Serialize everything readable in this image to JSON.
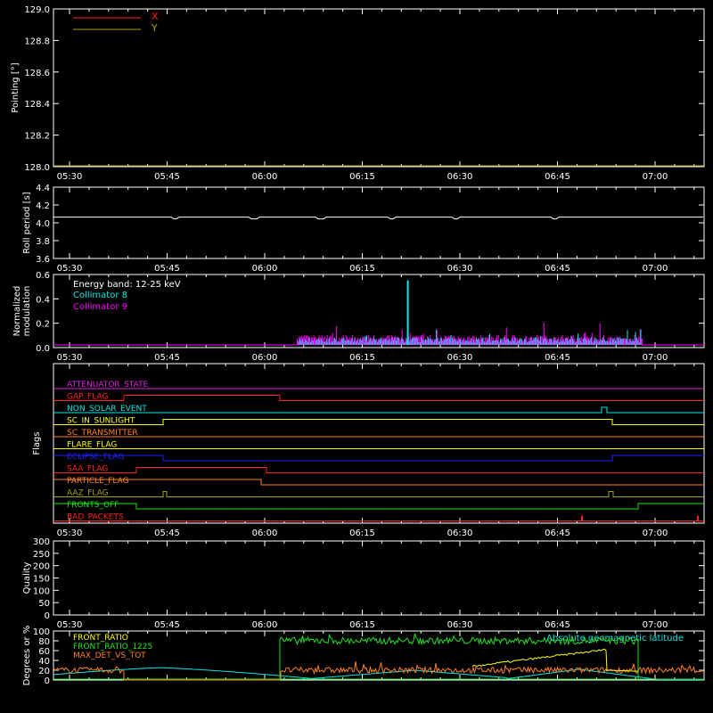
{
  "time_ticks": [
    "05:30",
    "05:45",
    "06:00",
    "06:15",
    "06:30",
    "06:45",
    "07:00"
  ],
  "colors": {
    "red": "#ff2020",
    "olive": "#a8a020",
    "white": "#ffffff",
    "cyan": "#00e8e8",
    "magenta": "#ff00ff",
    "orange": "#ff8020",
    "yellow": "#ffff00",
    "blue": "#2020ff",
    "green": "#20e020",
    "purple": "#e020e0"
  },
  "chart_data": [
    {
      "type": "line",
      "ylabel": "Pointing [°]",
      "ylim": [
        128.0,
        129.0
      ],
      "yticks": [
        "129.0",
        "128.8",
        "128.6",
        "128.4",
        "128.2",
        "128.0"
      ],
      "legend": [
        {
          "name": "X",
          "color": "#ff2020"
        },
        {
          "name": "Y",
          "color": "#a8a020"
        }
      ],
      "series": []
    },
    {
      "type": "line",
      "ylabel": "Roll period [s]",
      "ylim": [
        3.5,
        4.5
      ],
      "yticks": [
        "4.4",
        "4.2",
        "4.0",
        "3.8",
        "3.6"
      ],
      "series": [
        {
          "color": "#ffffff",
          "value": 4.08
        }
      ]
    },
    {
      "type": "bar",
      "ylabel": [
        "Normalized",
        "modulation"
      ],
      "ylim": [
        0,
        0.6
      ],
      "yticks": [
        "0.6",
        "0.4",
        "0.2",
        "0.0"
      ],
      "annotations": [
        "Energy band: 12-25 keV",
        "Collimator 8",
        "Collimator 9"
      ],
      "series": [
        {
          "name": "Collimator 8",
          "color": "#00e8e8"
        },
        {
          "name": "Collimator 9",
          "color": "#ff00ff"
        }
      ],
      "active_range": [
        "06:05",
        "06:58"
      ],
      "peak": {
        "time": "06:22",
        "value": 0.58
      }
    },
    {
      "type": "line",
      "ylabel": "Flags",
      "flags": [
        {
          "name": "ATTENUATOR_STATE",
          "color": "#e020e0"
        },
        {
          "name": "GAP_FLAG",
          "color": "#ff2020"
        },
        {
          "name": "NON_SOLAR_EVENT",
          "color": "#00e8e8"
        },
        {
          "name": "SC_IN_SUNLIGHT",
          "color": "#ffff00"
        },
        {
          "name": "SC_TRANSMITTER",
          "color": "#ff8020"
        },
        {
          "name": "FLARE_FLAG",
          "color": "#ffff00"
        },
        {
          "name": "ECLIPSE_FLAG",
          "color": "#2020ff"
        },
        {
          "name": "SAA_FLAG",
          "color": "#ff2020"
        },
        {
          "name": "PARTICLE_FLAG",
          "color": "#ff8020"
        },
        {
          "name": "AAZ_FLAG",
          "color": "#a8a020"
        },
        {
          "name": "FRONTS_OFF",
          "color": "#20e020"
        },
        {
          "name": "BAD_PACKETS",
          "color": "#ff2020"
        }
      ]
    },
    {
      "type": "line",
      "ylabel": "Quality",
      "ylim": [
        0,
        300
      ],
      "yticks": [
        "300",
        "250",
        "200",
        "150",
        "100",
        "50",
        "0"
      ],
      "series": []
    },
    {
      "type": "line",
      "ylabel": "Degrees or %",
      "ylim": [
        0,
        100
      ],
      "yticks": [
        "100",
        "80",
        "60",
        "40",
        "20",
        "0"
      ],
      "series": [
        {
          "name": "FRONT_RATIO",
          "color": "#ffff00"
        },
        {
          "name": "FRONT_RATIO_1225",
          "color": "#20e020"
        },
        {
          "name": "MAX_DET_VS_TOT",
          "color": "#ff8020"
        },
        {
          "name": "Absolute geomagnetic latitude",
          "color": "#00e8e8"
        }
      ]
    }
  ]
}
